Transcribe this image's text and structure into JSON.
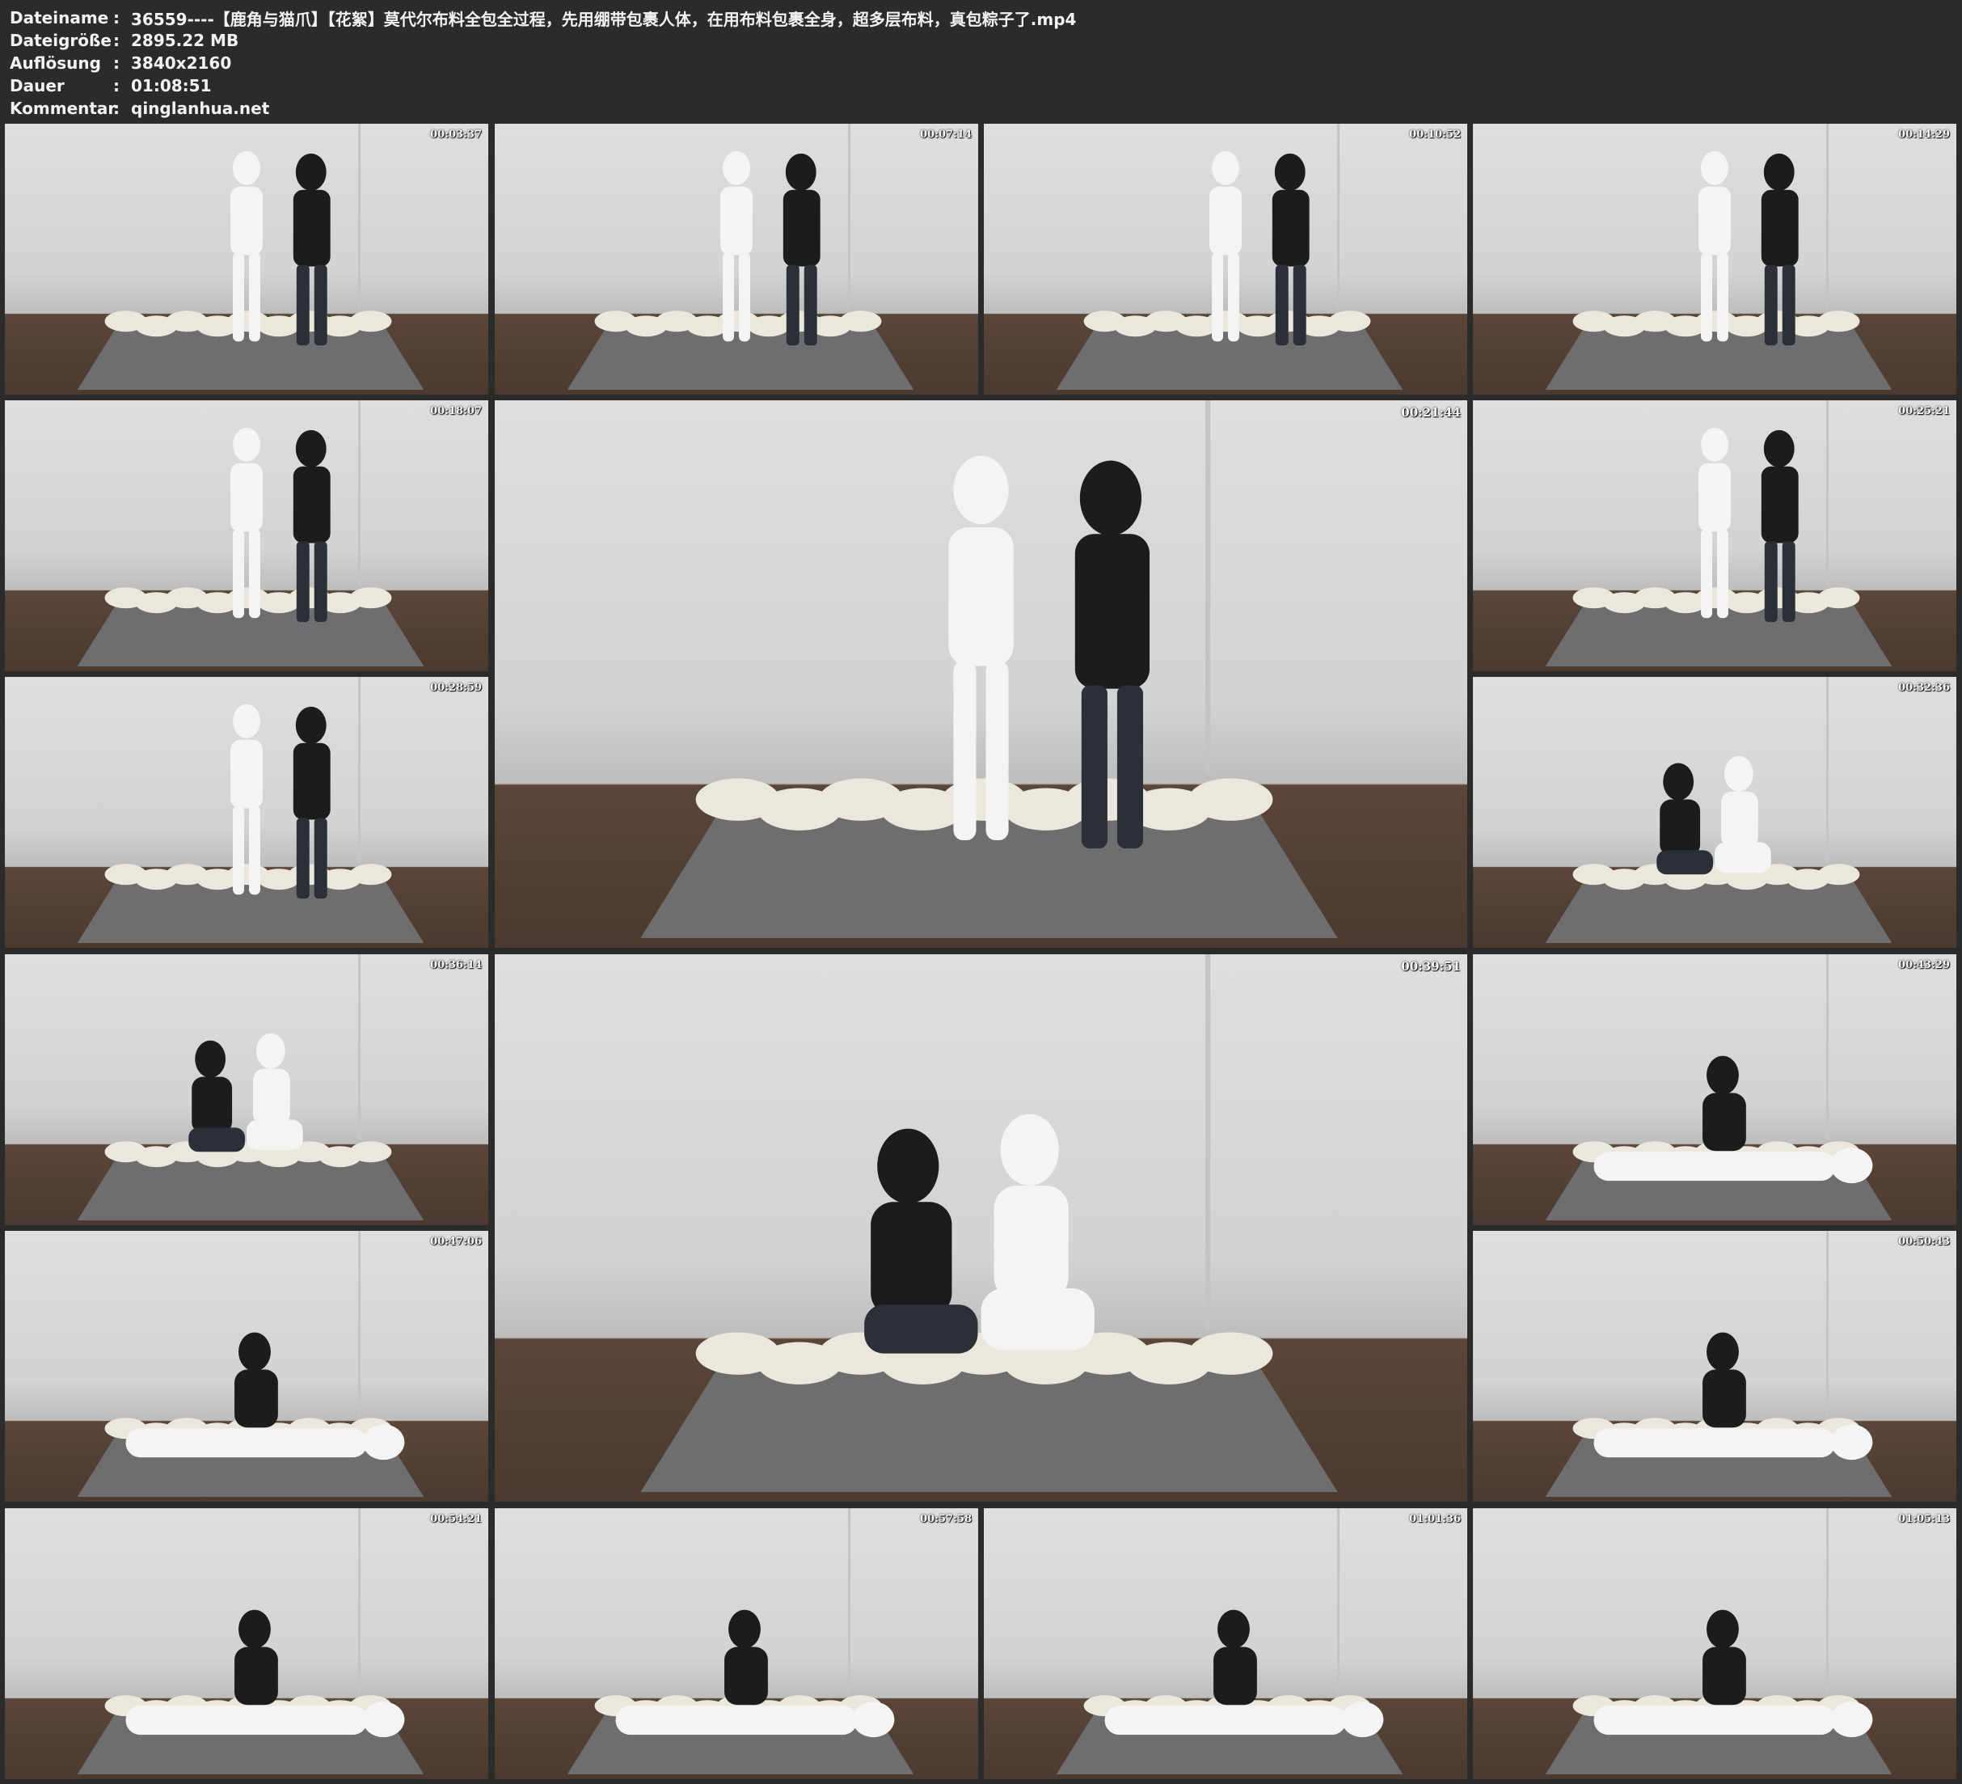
{
  "header": {
    "separator": ":",
    "rows": [
      {
        "label": "Dateiname",
        "value": "36559----【鹿角与猫爪】【花絮】莫代尔布料全包全过程，先用绷带包裹人体，在用布料包裹全身，超多层布料，真包粽子了.mp4"
      },
      {
        "label": "Dateigröße",
        "value": "2895.22 MB"
      },
      {
        "label": "Auflösung",
        "value": "3840x2160"
      },
      {
        "label": "Dauer",
        "value": "01:08:51"
      },
      {
        "label": "Kommentar",
        "value": "qinglanhua.net"
      }
    ]
  },
  "thumbnails": [
    {
      "timestamp": "00:03:37",
      "pose": "standing"
    },
    {
      "timestamp": "00:07:14",
      "pose": "standing"
    },
    {
      "timestamp": "00:10:52",
      "pose": "standing"
    },
    {
      "timestamp": "00:14:29",
      "pose": "standing"
    },
    {
      "timestamp": "00:18:07",
      "pose": "standing"
    },
    {
      "timestamp": "00:21:44",
      "pose": "standing"
    },
    {
      "timestamp": "00:25:21",
      "pose": "standing"
    },
    {
      "timestamp": "00:28:59",
      "pose": "standing"
    },
    {
      "timestamp": "00:32:36",
      "pose": "kneeling"
    },
    {
      "timestamp": "00:36:14",
      "pose": "kneeling"
    },
    {
      "timestamp": "00:39:51",
      "pose": "kneeling"
    },
    {
      "timestamp": "00:43:29",
      "pose": "lying"
    },
    {
      "timestamp": "00:47:06",
      "pose": "lying"
    },
    {
      "timestamp": "00:50:43",
      "pose": "lying"
    },
    {
      "timestamp": "00:54:21",
      "pose": "lying"
    },
    {
      "timestamp": "00:57:58",
      "pose": "lying"
    },
    {
      "timestamp": "01:01:36",
      "pose": "lying"
    },
    {
      "timestamp": "01:05:13",
      "pose": "lying"
    }
  ]
}
